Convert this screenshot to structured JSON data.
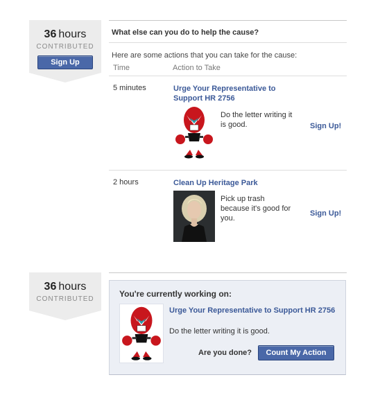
{
  "top_hours": {
    "number": "36",
    "unit": "hours",
    "label": "CONTRIBUTED",
    "button": "Sign Up"
  },
  "panel": {
    "question": "What else can you do to help the cause?",
    "intro": "Here are some actions that you can take for the cause:",
    "col_time": "Time",
    "col_action": "Action to Take",
    "actions": [
      {
        "time": "5 minutes",
        "title": "Urge Your Representative to Support HR 2756",
        "desc": "Do the letter writing it is good.",
        "signup": "Sign Up!",
        "thumb": "robot-icon"
      },
      {
        "time": "2 hours",
        "title": "Clean Up Heritage Park",
        "desc": "Pick up trash because it's good for you.",
        "signup": "Sign Up!",
        "thumb": "woman-portrait"
      }
    ]
  },
  "bottom_hours": {
    "number": "36",
    "unit": "hours",
    "label": "CONTRIBUTED"
  },
  "working": {
    "title": "You're currently working on:",
    "link": "Urge Your Representative to Support HR 2756",
    "desc": "Do the letter writing it is good.",
    "done_label": "Are you done?",
    "button": "Count My Action"
  },
  "colors": {
    "link": "#3b5998",
    "button": "#4a68a8",
    "ribbon": "#ececec",
    "working_bg": "#eceff5"
  }
}
